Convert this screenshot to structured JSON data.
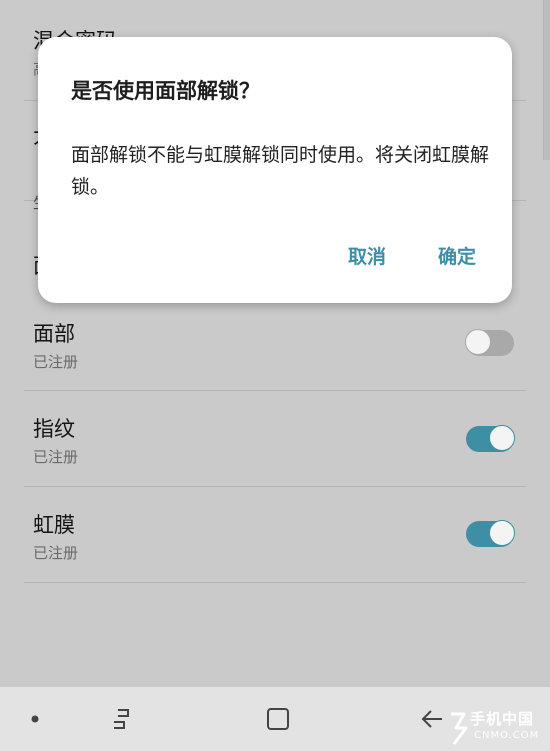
{
  "background_rows": {
    "row1": {
      "title": "混合密码",
      "sub": "高"
    },
    "row2": {
      "title": "大"
    },
    "section_header": "生",
    "row3": {
      "title": "面"
    }
  },
  "biometrics": [
    {
      "title": "面部",
      "status": "已注册",
      "enabled": false
    },
    {
      "title": "指纹",
      "status": "已注册",
      "enabled": true
    },
    {
      "title": "虹膜",
      "status": "已注册",
      "enabled": true
    }
  ],
  "dialog": {
    "title": "是否使用面部解锁？",
    "message": "面部解锁不能与虹膜解锁同时使用。将关闭虹膜解锁。",
    "cancel_label": "取消",
    "confirm_label": "确定"
  },
  "navigation": {
    "icons": [
      "dot-icon",
      "recent-apps-icon",
      "home-icon",
      "back-icon"
    ]
  },
  "watermark": {
    "main": "手机中国",
    "sub": "CNMO.COM"
  },
  "colors": {
    "accent": "#3e8fa4",
    "dimmed_background": "#cacaca",
    "dialog_background": "#ffffff",
    "navbar_background": "#e3e3e3"
  }
}
